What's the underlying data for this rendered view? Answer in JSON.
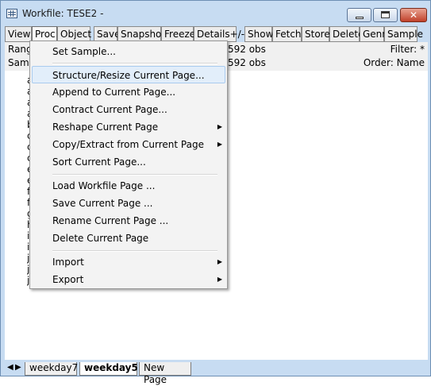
{
  "window": {
    "title": "Workfile: TESE2 -"
  },
  "toolbar": [
    "View",
    "Proc",
    "Object",
    "Save",
    "Snapshot",
    "Freeze",
    "Details+/-",
    "Show",
    "Fetch",
    "Store",
    "Delete",
    "Genr",
    "Sample"
  ],
  "info": {
    "range_label": "Rang",
    "range_obs": "592 obs",
    "filter": "Filter: *",
    "sample_label": "Samp",
    "sample_obs": "592 obs",
    "order": "Order: Name"
  },
  "menu": {
    "set_sample": "Set Sample...",
    "structure_resize": "Structure/Resize Current Page...",
    "append": "Append to Current Page...",
    "contract": "Contract Current Page...",
    "reshape": "Reshape Current Page",
    "copy_extract": "Copy/Extract from Current Page",
    "sort": "Sort Current Page...",
    "load": "Load Workfile Page ...",
    "save": "Save Current Page ...",
    "rename": "Rename Current Page ...",
    "delete": "Delete Current Page",
    "import": "Import",
    "export": "Export"
  },
  "objects": [
    "a",
    "a",
    "a",
    "a",
    "b",
    "c",
    "c",
    "c",
    "e",
    "e",
    "f",
    "f",
    "g",
    "h",
    "i",
    "i",
    "j",
    "j",
    "j"
  ],
  "tabs": [
    "weekday7",
    "weekday5",
    "New Page"
  ]
}
